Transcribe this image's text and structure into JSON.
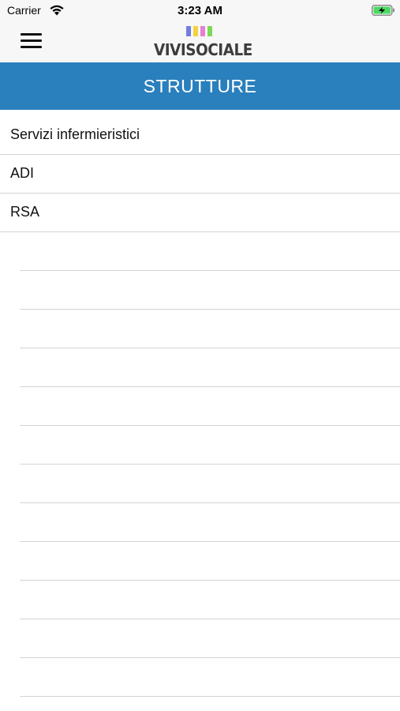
{
  "status_bar": {
    "carrier": "Carrier",
    "time": "3:23 AM",
    "wifi_icon": "wifi-icon",
    "battery_icon": "battery-charging-icon",
    "battery_color": "#4cd964"
  },
  "nav": {
    "menu_icon": "hamburger-menu-icon",
    "logo_text": "VIVISOCIALE",
    "logo_bar_colors": [
      "#6f7fe0",
      "#f4d03f",
      "#e77fd3",
      "#7ed957"
    ]
  },
  "header": {
    "title": "STRUTTURE",
    "color": "#2a7fbd"
  },
  "list": {
    "items": [
      {
        "label": "Servizi infermieristici"
      },
      {
        "label": "ADI"
      },
      {
        "label": "RSA"
      }
    ]
  }
}
